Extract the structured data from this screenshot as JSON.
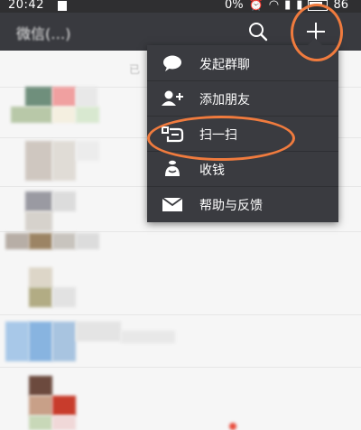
{
  "status_bar": {
    "time": "20:42",
    "network": "0%",
    "battery": "86"
  },
  "app_bar": {
    "title": "微信(…)"
  },
  "menu": {
    "items": [
      {
        "label": "发起群聊",
        "icon": "chat-bubble-icon"
      },
      {
        "label": "添加朋友",
        "icon": "add-friend-icon"
      },
      {
        "label": "扫一扫",
        "icon": "scan-icon"
      },
      {
        "label": "收钱",
        "icon": "money-bag-icon"
      },
      {
        "label": "帮助与反馈",
        "icon": "mail-icon"
      }
    ]
  },
  "background": {
    "partial_text": "已"
  },
  "colors": {
    "app_bar": "#393a3f",
    "menu_bg": "#3a3b40",
    "annotation": "#f07b3e"
  }
}
